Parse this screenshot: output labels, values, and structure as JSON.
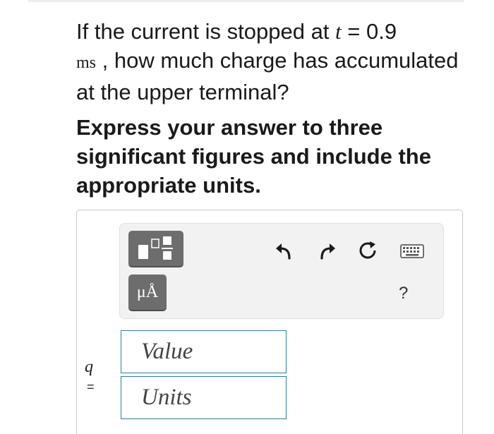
{
  "question": {
    "part1": "If the current is stopped at ",
    "var_t": "t",
    "equals_value": " = 0.9",
    "unit": "ms",
    "part2": " , how much charge has accumulated at the upper terminal?"
  },
  "instructions": "Express your answer to three significant figures and include the appropriate units.",
  "toolbar": {
    "units_label": "μÅ",
    "help_label": "?",
    "icons": [
      "templates-icon",
      "units-icon",
      "undo-icon",
      "redo-icon",
      "reset-icon",
      "keyboard-icon",
      "help-icon"
    ]
  },
  "answer": {
    "variable": "q",
    "equals": "=",
    "value_placeholder": "Value",
    "units_placeholder": "Units"
  },
  "colors": {
    "toolbar_button": "#6d6d6d",
    "field_border": "#2f7f8f",
    "toolbar_bg": "#f2f2f2"
  }
}
